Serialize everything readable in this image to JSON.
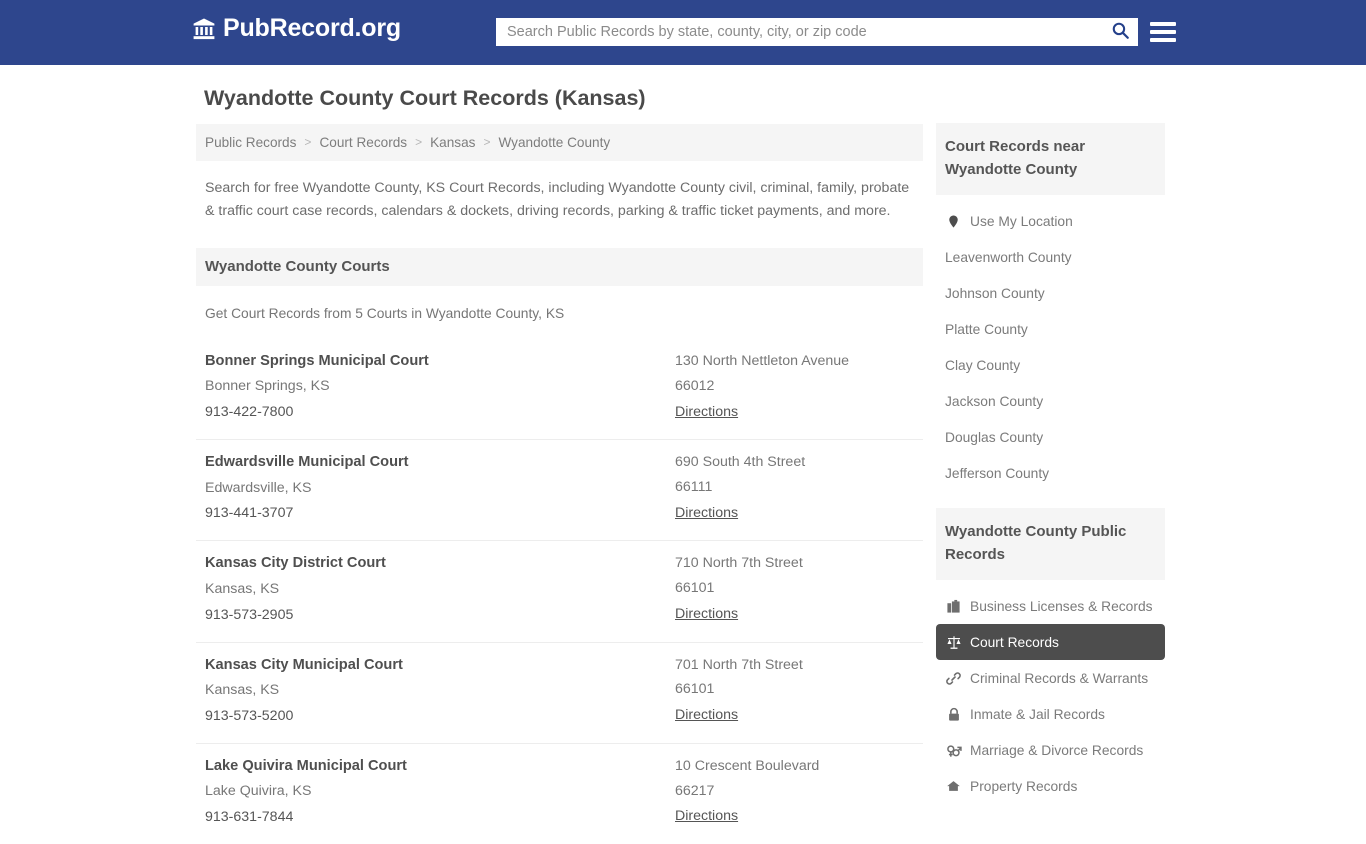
{
  "header": {
    "brand_name": "PubRecord.org",
    "brand_icon": "bank-building-icon",
    "search_placeholder": "Search Public Records by state, county, city, or zip code",
    "search_value": "",
    "search_icon": "search-icon",
    "menu_icon": "hamburger-menu-icon",
    "background_color": "#2e468d"
  },
  "main": {
    "title": "Wyandotte County Court Records (Kansas)",
    "breadcrumb": [
      "Public Records",
      "Court Records",
      "Kansas",
      "Wyandotte County"
    ],
    "breadcrumb_separator": ">",
    "intro": "Search for free Wyandotte County, KS Court Records, including Wyandotte County civil, criminal, family, probate & traffic court case records, calendars & dockets, driving records, parking & traffic ticket payments, and more.",
    "section_title": "Wyandotte County Courts",
    "section_subtitle": "Get Court Records from 5 Courts in Wyandotte County, KS",
    "directions_label": "Directions",
    "courts": [
      {
        "name": "Bonner Springs Municipal Court",
        "city_state": "Bonner Springs, KS",
        "phone": "913-422-7800",
        "address": "130 North Nettleton Avenue",
        "zip": "66012"
      },
      {
        "name": "Edwardsville Municipal Court",
        "city_state": "Edwardsville, KS",
        "phone": "913-441-3707",
        "address": "690 South 4th Street",
        "zip": "66111"
      },
      {
        "name": "Kansas City District Court",
        "city_state": "Kansas, KS",
        "phone": "913-573-2905",
        "address": "710 North 7th Street",
        "zip": "66101"
      },
      {
        "name": "Kansas City Municipal Court",
        "city_state": "Kansas, KS",
        "phone": "913-573-5200",
        "address": "701 North 7th Street",
        "zip": "66101"
      },
      {
        "name": "Lake Quivira Municipal Court",
        "city_state": "Lake Quivira, KS",
        "phone": "913-631-7844",
        "address": "10 Crescent Boulevard",
        "zip": "66217"
      }
    ]
  },
  "sidebar": {
    "nearby_title": "Court Records near Wyandotte County",
    "nearby_items": [
      {
        "label": "Use My Location",
        "icon": "map-pin-icon"
      },
      {
        "label": "Leavenworth County",
        "icon": ""
      },
      {
        "label": "Johnson County",
        "icon": ""
      },
      {
        "label": "Platte County",
        "icon": ""
      },
      {
        "label": "Clay County",
        "icon": ""
      },
      {
        "label": "Jackson County",
        "icon": ""
      },
      {
        "label": "Douglas County",
        "icon": ""
      },
      {
        "label": "Jefferson County",
        "icon": ""
      }
    ],
    "records_title": "Wyandotte County Public Records",
    "records_items": [
      {
        "label": "Business Licenses & Records",
        "icon": "briefcase-icon",
        "active": false
      },
      {
        "label": "Court Records",
        "icon": "scales-of-justice-icon",
        "active": true
      },
      {
        "label": "Criminal Records & Warrants",
        "icon": "chain-link-icon",
        "active": false
      },
      {
        "label": "Inmate & Jail Records",
        "icon": "padlock-icon",
        "active": false
      },
      {
        "label": "Marriage & Divorce Records",
        "icon": "gender-symbols-icon",
        "active": false
      },
      {
        "label": "Property Records",
        "icon": "house-icon",
        "active": false
      }
    ],
    "active_background_color": "#4d4d4d"
  }
}
